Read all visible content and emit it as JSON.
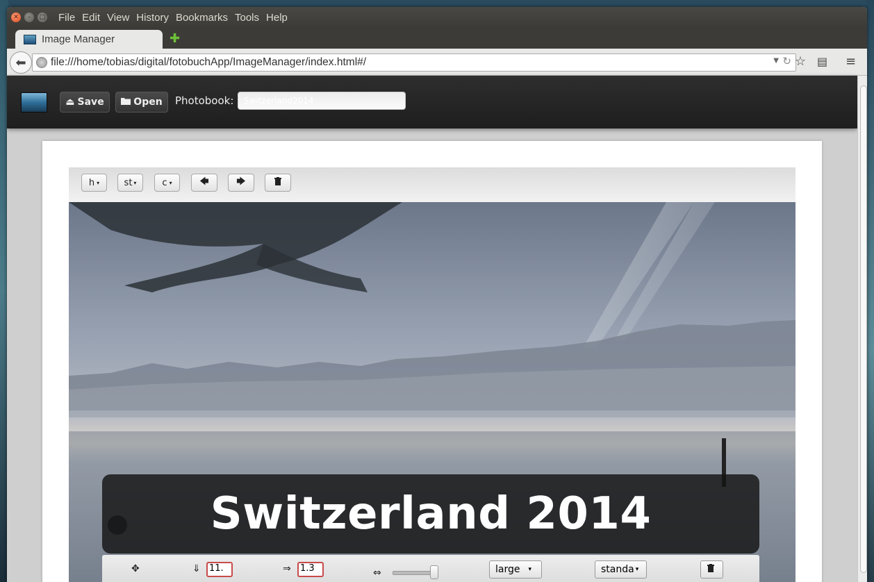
{
  "menubar": {
    "items": [
      "File",
      "Edit",
      "View",
      "History",
      "Bookmarks",
      "Tools",
      "Help"
    ]
  },
  "tab": {
    "title": "Image Manager"
  },
  "navbar": {
    "url": "file:///home/tobias/digital/fotobuchApp/ImageManager/index.html#/"
  },
  "app": {
    "save_label": "Save",
    "open_label": "Open",
    "photobook_label": "Photobook:",
    "photobook_value": "Switzerland2014"
  },
  "photo_toolbar": {
    "dropdown1": "h",
    "dropdown2": "st",
    "dropdown3": "c"
  },
  "caption": {
    "text": "Switzerland 2014"
  },
  "controls": {
    "vertical_value": "11.",
    "horizontal_value": "1.3",
    "size_select": "large",
    "style_select": "standa"
  }
}
